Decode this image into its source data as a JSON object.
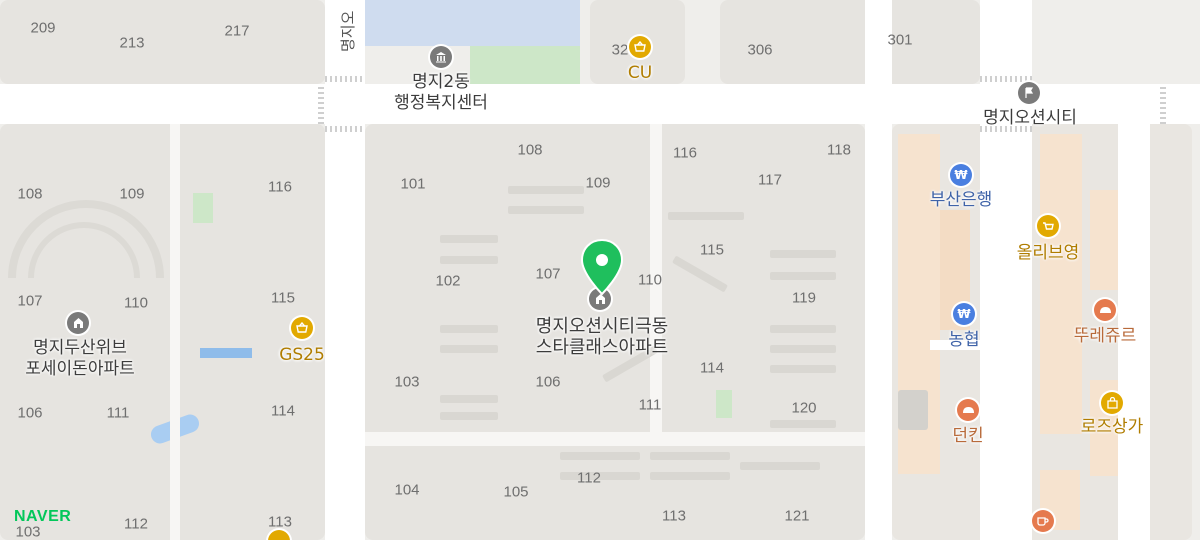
{
  "map": {
    "brand": "NAVER",
    "road_label": "명지오",
    "selected_place": {
      "line1": "명지오션시티극동",
      "line2": "스타클래스아파트"
    },
    "places": [
      {
        "id": "community-center",
        "line1": "명지2동",
        "line2": "행정복지센터",
        "icon": "government-building-icon",
        "color": "#7a7a7a"
      },
      {
        "id": "cu",
        "line1": "CU",
        "line2": "",
        "icon": "convenience-store-icon",
        "color": "#e2a900"
      },
      {
        "id": "myeongji-ocean-city",
        "line1": "명지오션시티",
        "line2": "",
        "icon": "flag-icon",
        "color": "#7a7a7a"
      },
      {
        "id": "busan-bank",
        "line1": "부산은행",
        "line2": "",
        "icon": "bank-icon",
        "color": "#4a7fe0"
      },
      {
        "id": "olive-young",
        "line1": "올리브영",
        "line2": "",
        "icon": "shopping-basket-icon",
        "color": "#e2a900"
      },
      {
        "id": "nonghyup",
        "line1": "농협",
        "line2": "",
        "icon": "bank-icon",
        "color": "#4a7fe0"
      },
      {
        "id": "tous-les-jours",
        "line1": "뚜레쥬르",
        "line2": "",
        "icon": "bakery-icon",
        "color": "#e57a4e"
      },
      {
        "id": "dunkin",
        "line1": "던킨",
        "line2": "",
        "icon": "bakery-icon",
        "color": "#e57a4e"
      },
      {
        "id": "rose-mall",
        "line1": "로즈상가",
        "line2": "",
        "icon": "shopping-bag-icon",
        "color": "#e2a900"
      },
      {
        "id": "gs25",
        "line1": "GS25",
        "line2": "",
        "icon": "convenience-store-icon",
        "color": "#e2a900"
      },
      {
        "id": "doosan-weve",
        "line1": "명지두산위브",
        "line2": "포세이돈아파트",
        "icon": "apartment-icon",
        "color": "#7a7a7a"
      }
    ],
    "building_numbers": [
      "209",
      "213",
      "217",
      "32",
      "306",
      "301",
      "108",
      "116",
      "118",
      "101",
      "109",
      "117",
      "108",
      "109",
      "116",
      "115",
      "107",
      "110",
      "102",
      "119",
      "107",
      "110",
      "115",
      "106",
      "114",
      "103",
      "111",
      "120",
      "106",
      "111",
      "114",
      "104",
      "105",
      "112",
      "113",
      "121",
      "112",
      "113",
      "103"
    ]
  }
}
